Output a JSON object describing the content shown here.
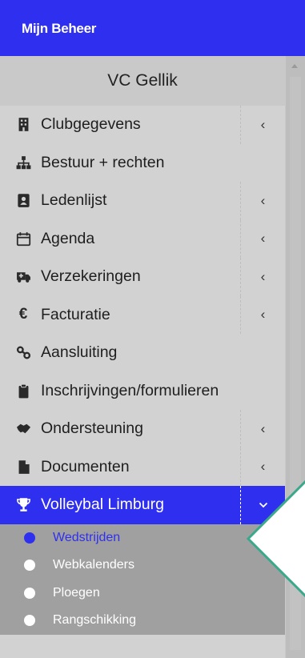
{
  "header": {
    "title": "Mijn Beheer"
  },
  "club": {
    "name": "VC Gellik"
  },
  "menu": [
    {
      "label": "Clubgegevens",
      "icon": "building-icon",
      "chevron": "‹"
    },
    {
      "label": "Bestuur + rechten",
      "icon": "sitemap-icon",
      "chevron": ""
    },
    {
      "label": "Ledenlijst",
      "icon": "address-book-icon",
      "chevron": "‹"
    },
    {
      "label": "Agenda",
      "icon": "calendar-icon",
      "chevron": "‹"
    },
    {
      "label": "Verzekeringen",
      "icon": "ambulance-icon",
      "chevron": "‹"
    },
    {
      "label": "Facturatie",
      "icon": "euro-icon",
      "glyph": "€",
      "chevron": "‹"
    },
    {
      "label": "Aansluiting",
      "icon": "link-icon",
      "chevron": ""
    },
    {
      "label": "Inschrijvingen/formulieren",
      "icon": "clipboard-icon",
      "chevron": ""
    },
    {
      "label": "Ondersteuning",
      "icon": "handshake-icon",
      "chevron": "‹"
    },
    {
      "label": "Documenten",
      "icon": "file-icon",
      "chevron": "‹"
    },
    {
      "label": "Volleybal Limburg",
      "icon": "trophy-icon",
      "chevron": "⌄",
      "active": true
    }
  ],
  "submenu": [
    {
      "label": "Wedstrijden",
      "selected": true
    },
    {
      "label": "Webkalenders"
    },
    {
      "label": "Ploegen"
    },
    {
      "label": "Rangschikking"
    }
  ],
  "colors": {
    "accent": "#2f2ff0",
    "callout": "#3aa88a"
  }
}
